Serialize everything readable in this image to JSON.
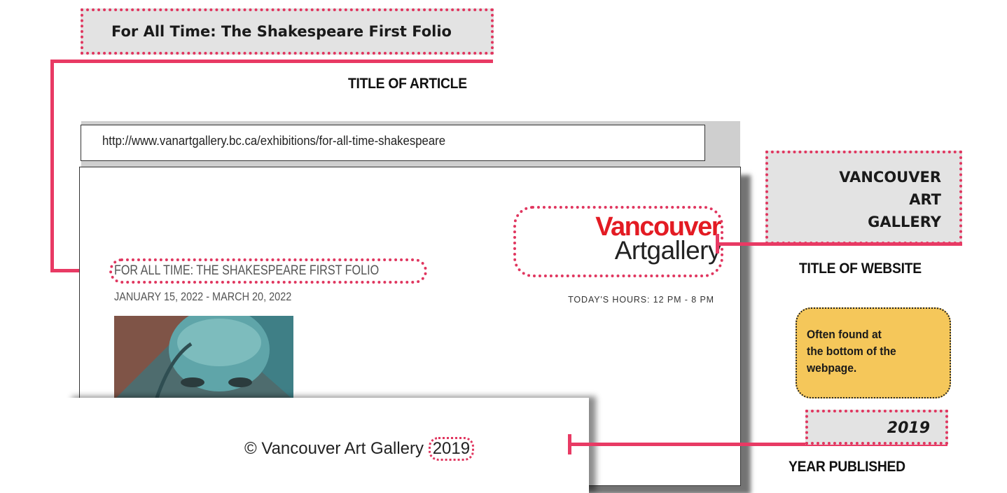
{
  "callouts": {
    "article_box": "For All Time: The Shakespeare First Folio",
    "article_caption": "TITLE OF ARTICLE",
    "website_box": [
      "VANCOUVER",
      "ART",
      "GALLERY"
    ],
    "website_caption": "TITLE OF WEBSITE",
    "note": "Often found at the bottom of the webpage.",
    "year_box": "2019",
    "year_caption": "YEAR PUBLISHED"
  },
  "browser": {
    "url": "http://www.vanartgallery.bc.ca/exhibitions/for-all-time-shakespeare"
  },
  "page": {
    "logo_top": "Vancouver",
    "logo_bottom": "Artgallery",
    "hours": "TODAY'S HOURS: 12 PM - 8 PM",
    "exhibition_title": "FOR ALL TIME: THE SHAKESPEARE FIRST FOLIO",
    "exhibition_dates": "JANUARY 15, 2022 - MARCH 20, 2022",
    "footer_copyright": "© Vancouver Art Gallery",
    "footer_year": "2019"
  },
  "colors": {
    "accent_pink": "#e83a64",
    "logo_red": "#e31b23",
    "callout_gray": "#e3e3e3",
    "note_yellow": "#f5c75a"
  }
}
